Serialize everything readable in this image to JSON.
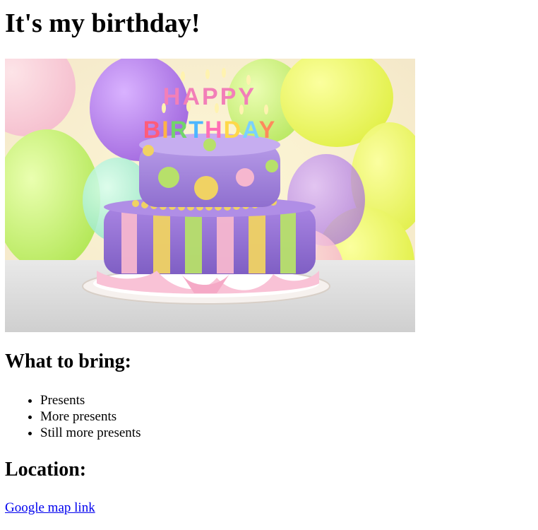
{
  "page": {
    "title": "It's my birthday!"
  },
  "hero_image": {
    "cake_topper_text": "HAPPY BIRTHDAY"
  },
  "bring_section": {
    "heading": "What to bring:",
    "items": [
      "Presents",
      "More presents",
      "Still more presents"
    ]
  },
  "location_section": {
    "heading": "Location:",
    "link_text": "Google map link"
  },
  "colors": {
    "link": "#0000ee",
    "text": "#000000",
    "background": "#ffffff"
  }
}
